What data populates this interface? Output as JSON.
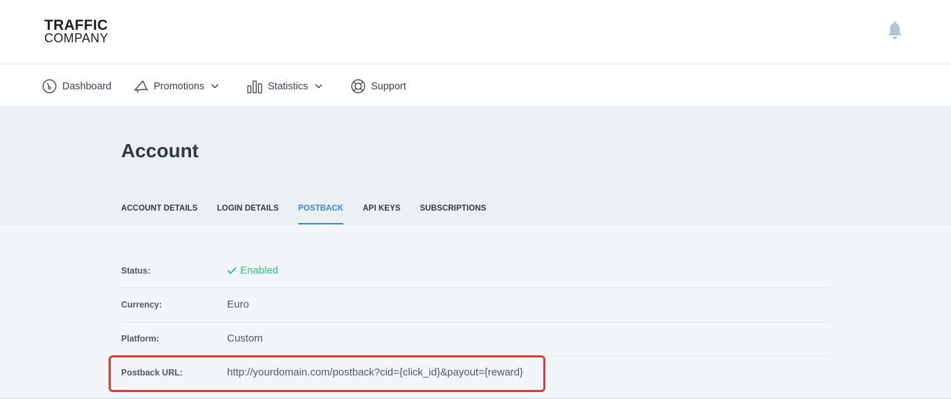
{
  "brand": {
    "line1": "TRAFFIC",
    "line2": "COMPANY"
  },
  "header": {
    "notification_icon": "bell-icon"
  },
  "nav": {
    "dashboard": "Dashboard",
    "promotions": "Promotions",
    "statistics": "Statistics",
    "support": "Support"
  },
  "page": {
    "title": "Account"
  },
  "tabs": {
    "account_details": "ACCOUNT DETAILS",
    "login_details": "LOGIN DETAILS",
    "postback": "POSTBACK",
    "api_keys": "API KEYS",
    "subscriptions": "SUBSCRIPTIONS",
    "active": "POSTBACK"
  },
  "postback": {
    "status_label": "Status:",
    "status_value": "Enabled",
    "currency_label": "Currency:",
    "currency_value": "Euro",
    "platform_label": "Platform:",
    "platform_value": "Custom",
    "url_label": "Postback URL:",
    "url_value": "http://yourdomain.com/postback?cid={click_id}&payout={reward}"
  },
  "colors": {
    "accent": "#3a86d1",
    "enabled": "#2ec27e",
    "highlight": "#dd3a34",
    "bell": "#b7c4d3"
  }
}
